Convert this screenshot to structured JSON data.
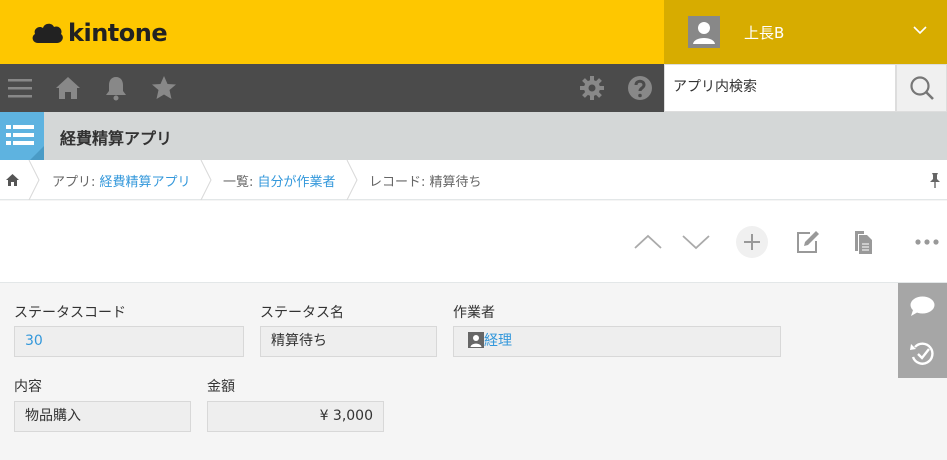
{
  "header": {
    "logo_text": "kintone",
    "user_name": "上長B",
    "brand_color": "#fec700"
  },
  "navbar": {
    "search_placeholder": "アプリ内検索",
    "icons": [
      "menu-icon",
      "home-icon",
      "bell-icon",
      "star-icon",
      "gear-icon",
      "help-icon",
      "search-icon"
    ]
  },
  "app": {
    "title": "経費精算アプリ"
  },
  "breadcrumb": {
    "app_prefix": "アプリ: ",
    "app_name": "経費精算アプリ",
    "view_prefix": "一覧: ",
    "view_name": "自分が作業者",
    "record_label": "レコード: 精算待ち"
  },
  "toolbar": {
    "icons": [
      "prev-record-icon",
      "next-record-icon",
      "add-record-icon",
      "edit-icon",
      "duplicate-icon",
      "more-options-icon"
    ]
  },
  "fields": {
    "status_code": {
      "label": "ステータスコード",
      "value": "30"
    },
    "status_name": {
      "label": "ステータス名",
      "value": "精算待ち"
    },
    "assignee": {
      "label": "作業者",
      "value": "経理"
    },
    "content": {
      "label": "内容",
      "value": "物品購入"
    },
    "amount": {
      "label": "金額",
      "value": "¥ 3,000"
    }
  }
}
